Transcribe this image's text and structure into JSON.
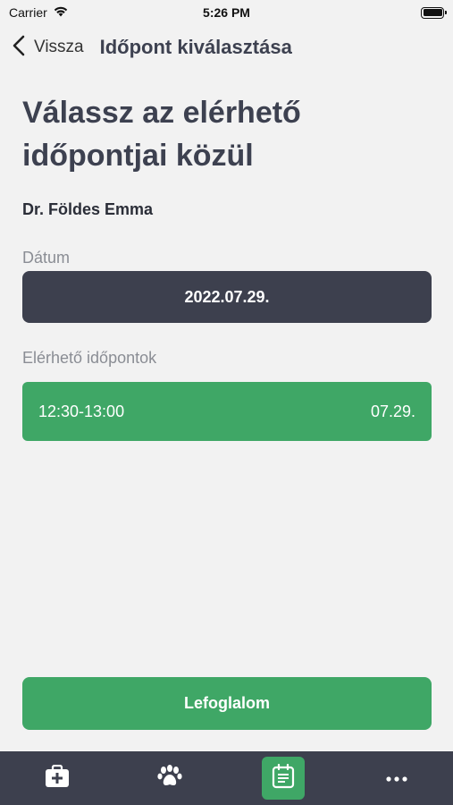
{
  "status_bar": {
    "carrier": "Carrier",
    "time": "5:26 PM"
  },
  "nav": {
    "back_label": "Vissza",
    "title": "Időpont kiválasztása"
  },
  "headline": "Válassz az elérhető időpontjai közül",
  "doctor_name": "Dr. Földes Emma",
  "date_section": {
    "label": "Dátum",
    "value": "2022.07.29."
  },
  "slots_section": {
    "label": "Elérhető időpontok",
    "slots": [
      {
        "time": "12:30-13:00",
        "date": "07.29."
      }
    ]
  },
  "book_button": "Lefoglalom",
  "tab_bar": {
    "tabs": [
      {
        "icon": "medical-kit-icon",
        "active": false
      },
      {
        "icon": "paw-icon",
        "active": false
      },
      {
        "icon": "calendar-list-icon",
        "active": true
      },
      {
        "icon": "more-icon",
        "active": false
      }
    ]
  },
  "colors": {
    "accent": "#3fa766",
    "dark": "#3d404e",
    "background": "#f2f2f2"
  }
}
